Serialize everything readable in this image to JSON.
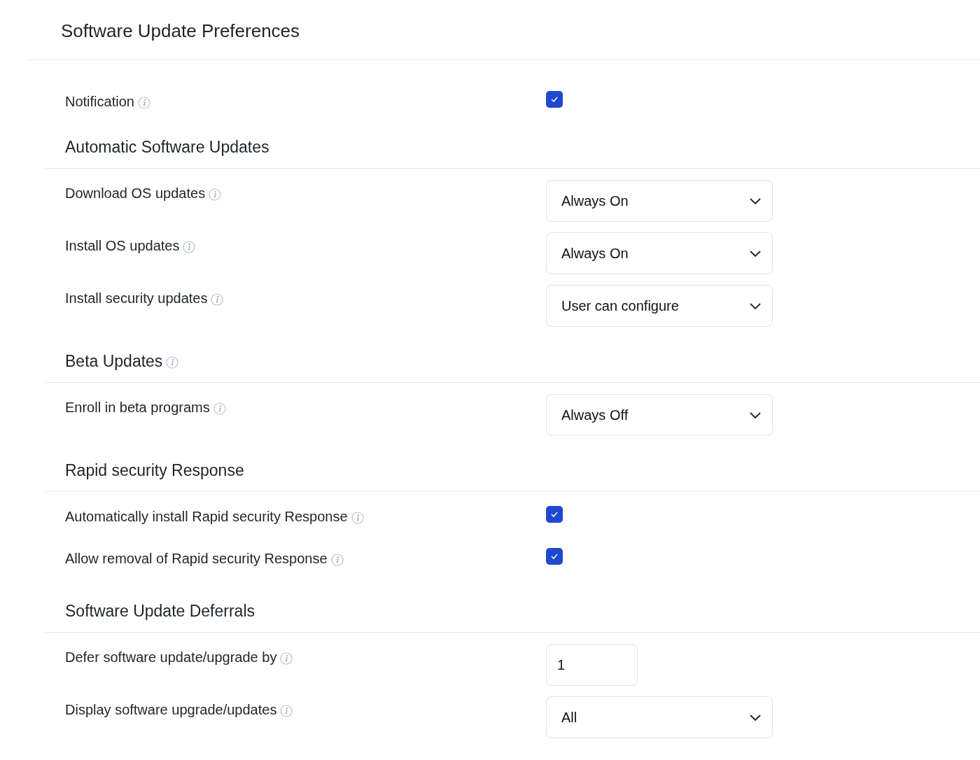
{
  "title": "Software Update Preferences",
  "sections": [
    {
      "rows": [
        {
          "label": "Notification",
          "kind": "checkbox",
          "checked": true
        }
      ]
    },
    {
      "heading": "Automatic Software Updates",
      "info": false,
      "rows": [
        {
          "label": "Download OS updates",
          "kind": "select",
          "value": "Always On"
        },
        {
          "label": "Install OS updates",
          "kind": "select",
          "value": "Always On"
        },
        {
          "label": "Install security updates",
          "kind": "select",
          "value": "User can configure"
        }
      ]
    },
    {
      "heading": "Beta Updates",
      "info": true,
      "rows": [
        {
          "label": "Enroll in beta programs",
          "kind": "select",
          "value": "Always Off"
        }
      ]
    },
    {
      "heading": "Rapid security Response",
      "info": false,
      "rows": [
        {
          "label": "Automatically install Rapid security Response",
          "kind": "checkbox",
          "checked": true
        },
        {
          "label": "Allow removal of Rapid security Response",
          "kind": "checkbox",
          "checked": true
        }
      ]
    },
    {
      "heading": "Software Update Deferrals",
      "info": false,
      "rows": [
        {
          "label": "Defer software update/upgrade by",
          "kind": "number",
          "value": "1"
        },
        {
          "label": "Display software upgrade/updates",
          "kind": "select",
          "value": "All"
        }
      ]
    }
  ]
}
